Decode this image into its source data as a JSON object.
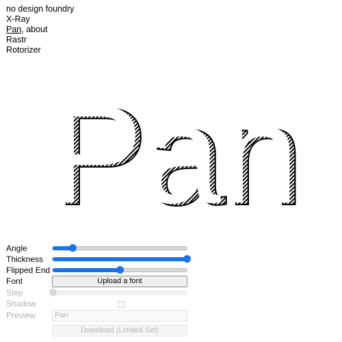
{
  "nav": {
    "foundry": "no design foundry",
    "items": [
      "X-Ray",
      "Pan",
      "Rastr",
      "Rotorizer"
    ],
    "current_suffix": ", about"
  },
  "preview_text": "Pan",
  "controls": {
    "angle": {
      "label": "Angle",
      "value": 0.15
    },
    "thickness": {
      "label": "Thickness",
      "value": 1.0
    },
    "flipped_end": {
      "label": "Flipped End",
      "value": 0.5
    },
    "font": {
      "label": "Font",
      "button": "Upload a font"
    },
    "step": {
      "label": "Step",
      "value": 0.0
    },
    "shadow": {
      "label": "Shadow",
      "checked": false
    },
    "preview": {
      "label": "Preview",
      "value": "Pan"
    },
    "download": {
      "label": "Download (Limited Set)"
    }
  },
  "colors": {
    "accent": "#1a73e8",
    "disabled_text": "#b0b0b0"
  }
}
